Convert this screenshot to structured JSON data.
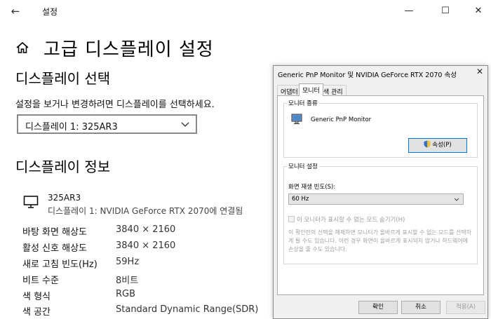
{
  "window": {
    "app_title": "설정",
    "back_glyph": "←",
    "minimize_glyph": "—",
    "maximize_glyph": "☐",
    "close_glyph": "✕"
  },
  "page": {
    "title": "고급 디스플레이 설정",
    "select_heading": "디스플레이 선택",
    "instruction": "설정을 보거나 변경하려면 디스플레이를 선택하세요.",
    "display_dropdown": "디스플레이 1: 325AR3",
    "info_heading": "디스플레이 정보",
    "monitor_name": "325AR3",
    "monitor_connection": "디스플레이 1: NVIDIA GeForce RTX 2070에 연결됨",
    "info": [
      {
        "key": "바탕 화면 해상도",
        "value": "3840 × 2160"
      },
      {
        "key": "활성 신호 해상도",
        "value": "3840 × 2160"
      },
      {
        "key": "새로 고침 빈도(Hz)",
        "value": "59Hz"
      },
      {
        "key": "비트 수준",
        "value": "8비트"
      },
      {
        "key": "색 형식",
        "value": "RGB"
      },
      {
        "key": "색 공간",
        "value": "Standard Dynamic Range(SDR)"
      }
    ]
  },
  "dialog": {
    "title": "Generic PnP Monitor 및 NVIDIA GeForce RTX 2070 속성",
    "close_glyph": "✕",
    "tabs": [
      "어댑터",
      "모니터",
      "색 관리"
    ],
    "monitor_type_group": "모니터 종류",
    "monitor_type_name": "Generic PnP Monitor",
    "properties_button": "속성(P)",
    "monitor_settings_group": "모니터 설정",
    "refresh_label": "화면 재생 빈도(S):",
    "refresh_value": "60 Hz",
    "hide_modes_label": "이 모니터가 표시할 수 없는 모드 숨기기(H)",
    "warning_text": "이 확인란의 선택을 해제하면 모니터가 올바르게 표시할 수 없는 모드를 선택하게 될 수도 있습니다. 이런 경우 화면이 올바르게 표시되지 않거나 하드웨어에 손상을 줄 수도 있습니다.",
    "ok_button": "확인",
    "cancel_button": "취소",
    "apply_button": "적용(A)"
  }
}
